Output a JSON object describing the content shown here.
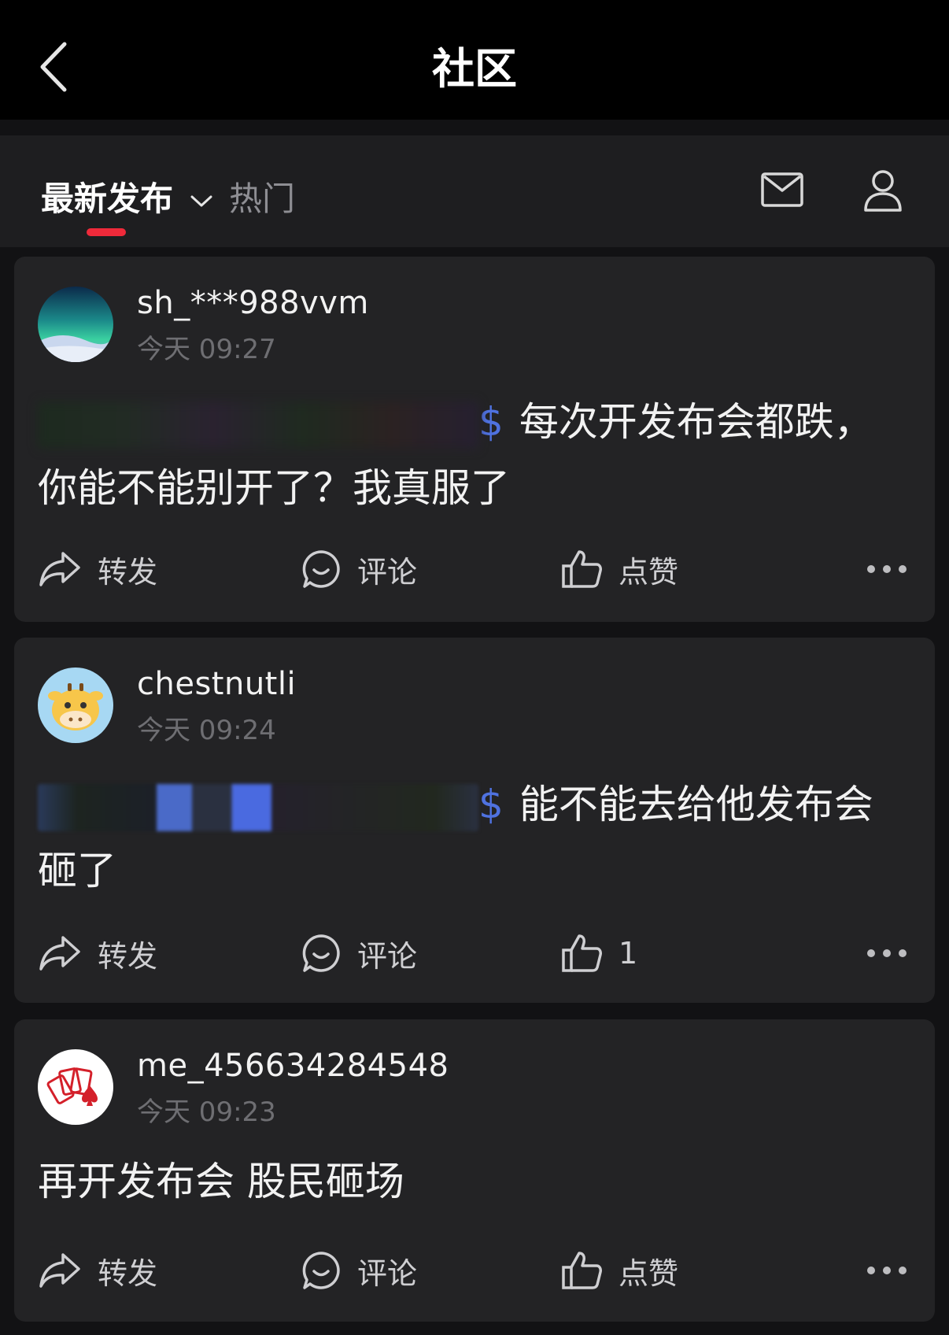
{
  "header": {
    "title": "社区",
    "back_icon": "chevron-left-icon"
  },
  "tabs": {
    "latest": "最新发布",
    "hot": "热门",
    "active": "latest",
    "accent": "#ef2a3a"
  },
  "posts": [
    {
      "username": "sh_***988vvm",
      "time": "今天 09:27",
      "content_prefix": "$",
      "content_line1": "每次开发布会都跌，",
      "content_line2": "你能不能别开了？我真服了",
      "share": "转发",
      "comment": "评论",
      "like": "点赞"
    },
    {
      "username": "chestnutli",
      "time": "今天 09:24",
      "content_prefix": "$",
      "content_line1": "能不能去给他发布会",
      "content_line2": "砸了",
      "share": "转发",
      "comment": "评论",
      "like": "1"
    },
    {
      "username": "me_456634284548",
      "time": "今天 09:23",
      "content_line1": "再开发布会 股民砸场",
      "share": "转发",
      "comment": "评论",
      "like": "点赞"
    }
  ]
}
